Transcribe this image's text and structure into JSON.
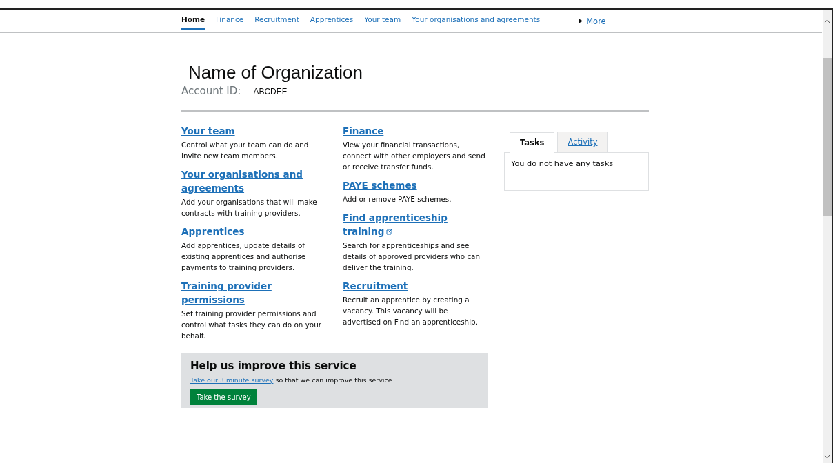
{
  "nav": [
    {
      "label": "Home",
      "selected": true
    },
    {
      "label": "Finance",
      "selected": false
    },
    {
      "label": "Recruitment",
      "selected": false
    },
    {
      "label": "Apprentices",
      "selected": false
    },
    {
      "label": "Your team",
      "selected": false
    },
    {
      "label": "Your organisations and agreements",
      "selected": false
    }
  ],
  "nav_more": "More",
  "heading": "Name of Organization",
  "account": {
    "label": "Account ID:",
    "value": "ABCDEF"
  },
  "columns": [
    [
      {
        "title": "Your team",
        "external": false,
        "text": "Control what your team can do and invite new team members."
      },
      {
        "title": "Your organisations and agreements",
        "external": false,
        "text": "Add your organisations that will make contracts with training providers."
      },
      {
        "title": "Apprentices",
        "external": false,
        "text": "Add apprentices, update details of existing apprentices and authorise payments to training providers."
      },
      {
        "title": "Training provider permissions",
        "external": false,
        "text": "Set training provider permissions and control what tasks they can do on your behalf."
      }
    ],
    [
      {
        "title": "Finance",
        "external": false,
        "text": "View your financial transactions, connect with other employers and send or receive transfer funds."
      },
      {
        "title": "PAYE schemes",
        "external": false,
        "text": "Add or remove PAYE schemes."
      },
      {
        "title": "Find apprenticeship training",
        "external": true,
        "text": "Search for apprenticeships and see details of approved providers who can deliver the training."
      },
      {
        "title": "Recruitment",
        "external": false,
        "text": "Recruit an apprentice by creating a vacancy. This vacancy will be advertised on Find an apprenticeship."
      }
    ]
  ],
  "tabs": [
    {
      "label": "Tasks",
      "selected": true
    },
    {
      "label": "Activity",
      "selected": false
    }
  ],
  "tab_panel": "You do not have any tasks",
  "feedback": {
    "title": "Help us improve this service",
    "link": "Take our 3 minute survey",
    "text": " so that we can improve this service.",
    "button": "Take the survey"
  }
}
